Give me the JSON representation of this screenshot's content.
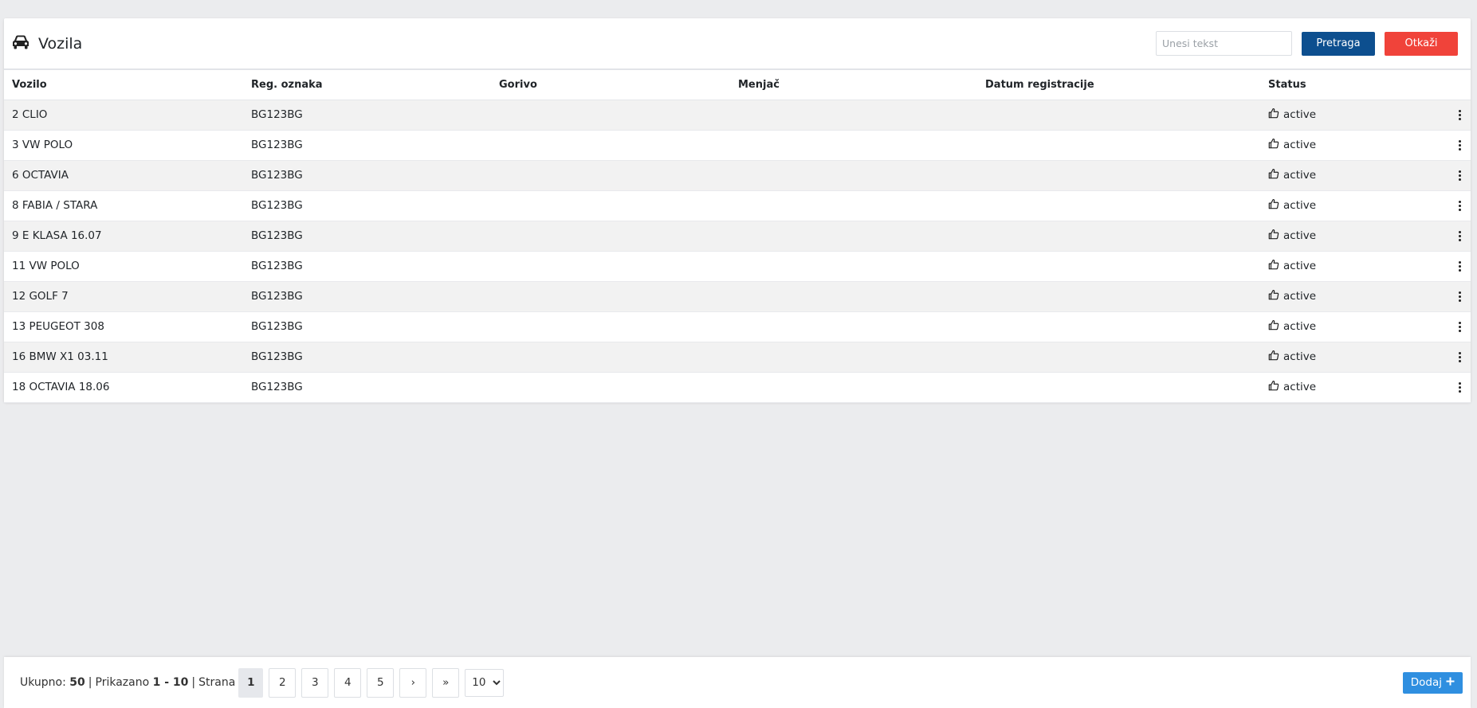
{
  "header": {
    "title": "Vozila",
    "icon": "car-icon",
    "search_placeholder": "Unesi tekst",
    "search_button": "Pretraga",
    "cancel_button": "Otkaži"
  },
  "table": {
    "columns": [
      "Vozilo",
      "Reg. oznaka",
      "Gorivo",
      "Menjač",
      "Datum registracije",
      "Status"
    ],
    "rows": [
      {
        "vozilo": "2 CLIO",
        "reg": "BG123BG",
        "gorivo": "",
        "menjac": "",
        "datum": "",
        "status": "active"
      },
      {
        "vozilo": "3 VW POLO",
        "reg": "BG123BG",
        "gorivo": "",
        "menjac": "",
        "datum": "",
        "status": "active"
      },
      {
        "vozilo": "6 OCTAVIA",
        "reg": "BG123BG",
        "gorivo": "",
        "menjac": "",
        "datum": "",
        "status": "active"
      },
      {
        "vozilo": "8 FABIA / STARA",
        "reg": "BG123BG",
        "gorivo": "",
        "menjac": "",
        "datum": "",
        "status": "active"
      },
      {
        "vozilo": "9 E KLASA 16.07",
        "reg": "BG123BG",
        "gorivo": "",
        "menjac": "",
        "datum": "",
        "status": "active"
      },
      {
        "vozilo": "11 VW POLO",
        "reg": "BG123BG",
        "gorivo": "",
        "menjac": "",
        "datum": "",
        "status": "active"
      },
      {
        "vozilo": "12 GOLF 7",
        "reg": "BG123BG",
        "gorivo": "",
        "menjac": "",
        "datum": "",
        "status": "active"
      },
      {
        "vozilo": "13 PEUGEOT 308",
        "reg": "BG123BG",
        "gorivo": "",
        "menjac": "",
        "datum": "",
        "status": "active"
      },
      {
        "vozilo": "16 BMW X1 03.11",
        "reg": "BG123BG",
        "gorivo": "",
        "menjac": "",
        "datum": "",
        "status": "active"
      },
      {
        "vozilo": "18 OCTAVIA 18.06",
        "reg": "BG123BG",
        "gorivo": "",
        "menjac": "",
        "datum": "",
        "status": "active"
      }
    ],
    "status_icon": "thumbs-up-icon",
    "row_menu_icon": "kebab-menu-icon"
  },
  "footer": {
    "total_label": "Ukupno:",
    "total_value": "50",
    "shown_label": "Prikazano",
    "shown_value": "1 - 10",
    "page_label": "Strana",
    "pages": [
      "1",
      "2",
      "3",
      "4",
      "5"
    ],
    "current_page": "1",
    "next_label": "›",
    "last_label": "»",
    "page_size": "10",
    "page_size_options": [
      "10"
    ],
    "add_button": "Dodaj"
  },
  "colors": {
    "search_button": "#0d4f8f",
    "cancel_button": "#f0433a",
    "add_button": "#2f8fe0",
    "page_background": "#ebecee"
  }
}
